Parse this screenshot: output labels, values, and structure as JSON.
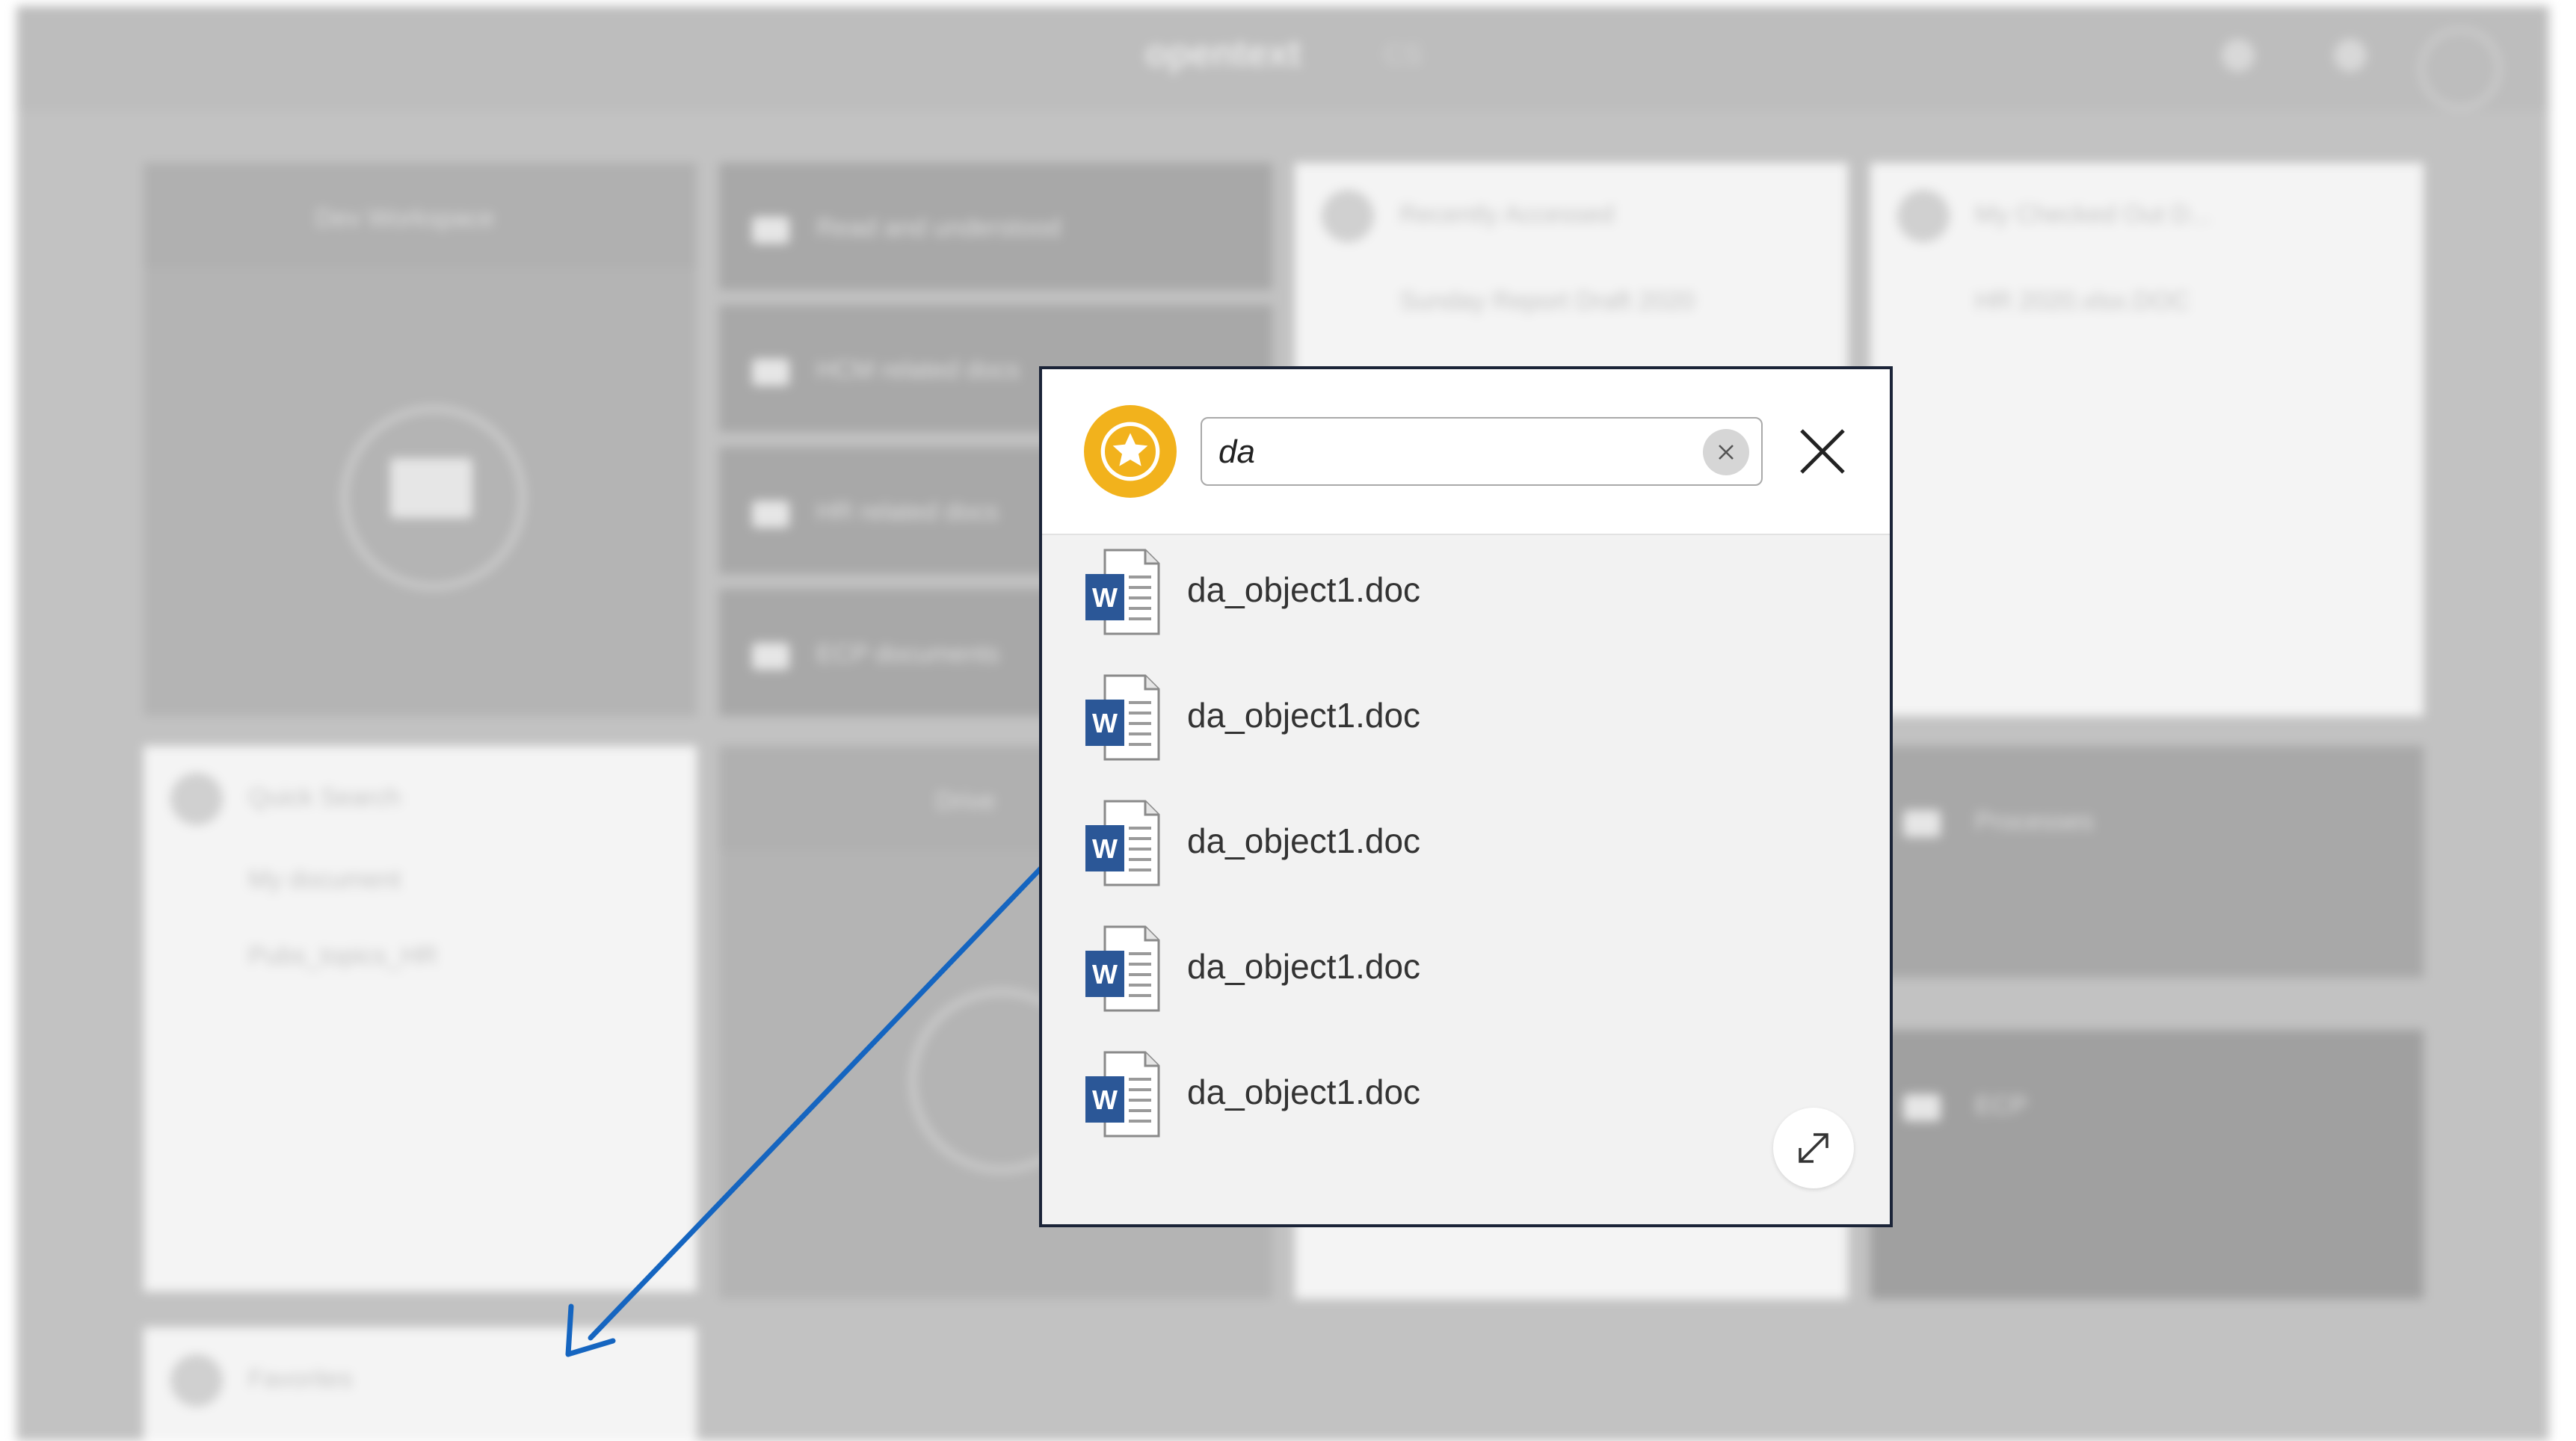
{
  "background": {
    "brand": "opentext",
    "brand_sub": "CS",
    "tiles": {
      "workspace": "Dev Workspace",
      "folder_1": "Read and understood",
      "folder_2": "HCM related docs",
      "folder_3": "HR related docs",
      "folder_4": "ECP documents",
      "recently_accessed": "Recently Accessed",
      "recent_item": "Sunday Report Draft 2020",
      "my_checked_out": "My Checked Out D...",
      "checked_out_item": "HR 2020.xlsx.DOC",
      "quick_search": "Quick Search",
      "qs_item_1": "My document",
      "qs_item_2": "Pubs_topics_HR",
      "ecp_tile": "ECP",
      "drive_tile": "Drive",
      "processes_tile": "Processes",
      "favorites": "Favorites"
    }
  },
  "popup": {
    "search_value": "da",
    "icons": {
      "header": "star-icon",
      "clear": "clear-x-icon",
      "close": "close-icon",
      "expand": "expand-icon",
      "result": "word-doc-icon"
    },
    "results": [
      {
        "name": "da_object1.doc"
      },
      {
        "name": "da_object1.doc"
      },
      {
        "name": "da_object1.doc"
      },
      {
        "name": "da_object1.doc"
      },
      {
        "name": "da_object1.doc"
      }
    ]
  },
  "colors": {
    "star_badge": "#f2b21c",
    "popup_border": "#1b2438",
    "arrow": "#1565c0",
    "word_blue": "#2b5797"
  }
}
